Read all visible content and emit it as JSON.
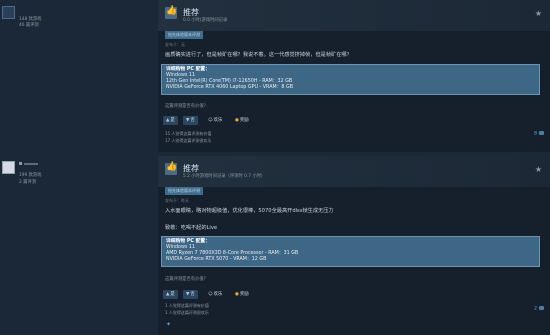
{
  "reviews": [
    {
      "author": {
        "name": "",
        "games_owned": "148 款游戏",
        "reviews_count": "46 篇评测"
      },
      "recommendation": "推荐",
      "hours": "0.0 小时(游戏时间记录",
      "tag": "抢先体验版本评测",
      "posted": "发布于：无",
      "body_lines": [
        "画质确实进行了，但是帧矿在哪？我说不着。这一代感觉挤掉帧，但是帧矿在哪？"
      ],
      "spec_title": "详细购物 PC 配置：",
      "specs": [
        "Windows 11",
        "12th Gen Intel(R) Core(TM) i7-12650H - RAM：32 GB",
        "NVIDIA GeForce RTX 4060 Laptop GPU - VRAM：8 GB"
      ],
      "helpful_question": "这篇评测是否有价值？",
      "votes": {
        "yes": "是",
        "no": "否",
        "funny": "欢乐",
        "award": "奖励"
      },
      "helpful_count": "15 人觉得这篇评测有价值",
      "funny_count": "17 人觉得这篇评测很欢乐",
      "comments": "8"
    },
    {
      "author": {
        "name": "",
        "games_owned": "199 款游戏",
        "reviews_count": "2 篇评测"
      },
      "recommendation": "推荐",
      "hours": "5.2 小时游戏时间记录（评测时 0.7 小时）",
      "tag": "抢先体验版本评测",
      "posted": "发布于：昨天",
      "body_lines": [
        "入水面眼睛，略对物超级值，优化很棒，5070全最高开dlss帧生成无压力",
        "致敬：吃喝不起的Live"
      ],
      "spec_title": "详细购物 PC 配置：",
      "specs": [
        "Windows 11",
        "AMD Ryzen 7 7800X3D 8-Core Processor - RAM：31 GB",
        "NVIDIA GeForce RTX 5070 - VRAM：12 GB"
      ],
      "helpful_question": "这篇评测是否有价值？",
      "votes": {
        "yes": "是",
        "no": "否",
        "funny": "欢乐",
        "award": "奖励"
      },
      "helpful_count": "1 人觉得这篇评测有价值",
      "funny_count": "1 人觉得这篇评测很欢乐",
      "comments": "2"
    }
  ]
}
